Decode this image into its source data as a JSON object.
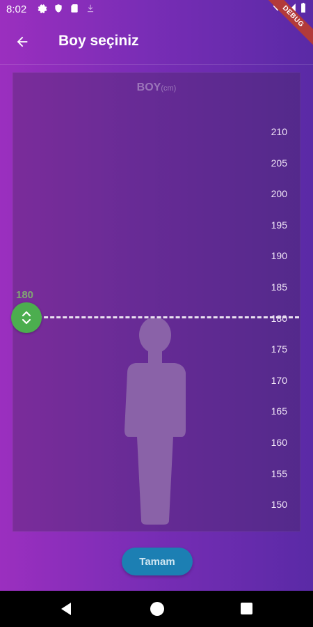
{
  "status_bar": {
    "time": "8:02",
    "left_icons": [
      "gear-icon",
      "shield-icon",
      "sd-card-icon",
      "download-icon"
    ],
    "right_icons": [
      "wifi-icon",
      "signal-icon",
      "battery-icon"
    ]
  },
  "debug_banner": "DEBUG",
  "app_bar": {
    "back_icon": "arrow-left-icon",
    "title": "Boy seçiniz"
  },
  "height_picker": {
    "title": "BOY",
    "unit": "(cm)",
    "selected_value": "180",
    "ticks": [
      "210",
      "205",
      "200",
      "195",
      "190",
      "185",
      "180",
      "175",
      "170",
      "165",
      "160",
      "155",
      "150"
    ]
  },
  "confirm_button": {
    "label": "Tamam"
  },
  "colors": {
    "background_start": "#9b2fbf",
    "background_end": "#5a2aa6",
    "handle": "#4cae4f",
    "button": "#1c7fb3",
    "silhouette": "#8a62a8"
  },
  "nav_bar": {
    "icons": [
      "nav-back-icon",
      "nav-home-icon",
      "nav-recents-icon"
    ]
  }
}
